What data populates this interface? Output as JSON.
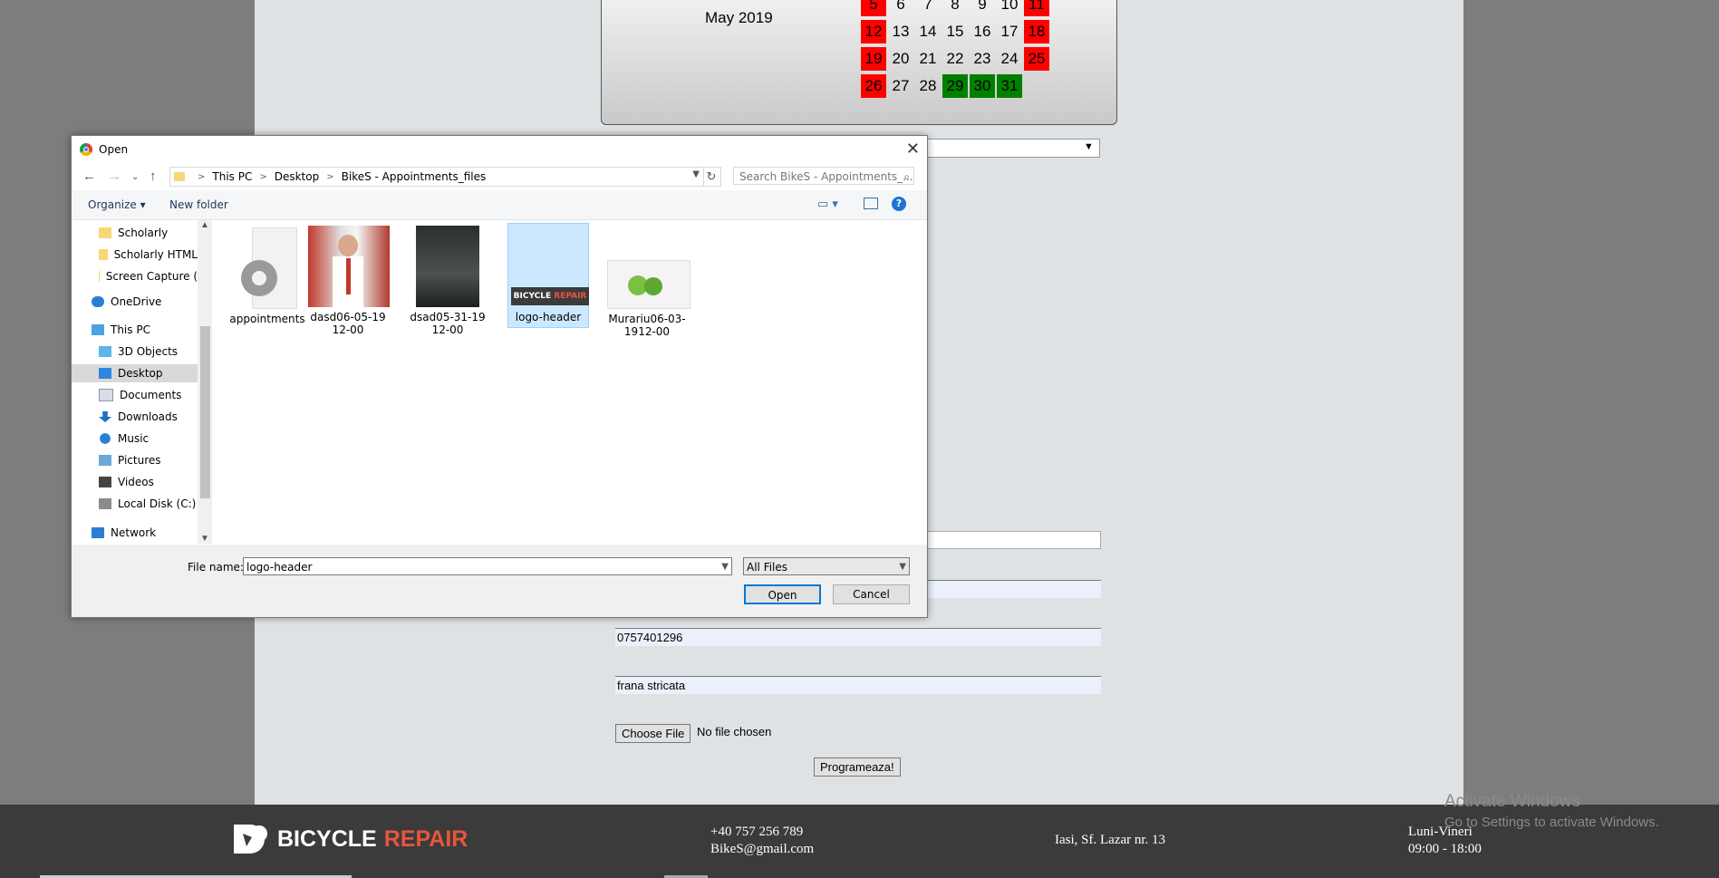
{
  "calendar": {
    "month_label": "May 2019",
    "rows": [
      [
        {
          "d": "5",
          "s": "red"
        },
        {
          "d": "6",
          "s": ""
        },
        {
          "d": "7",
          "s": ""
        },
        {
          "d": "8",
          "s": ""
        },
        {
          "d": "9",
          "s": ""
        },
        {
          "d": "10",
          "s": ""
        },
        {
          "d": "11",
          "s": "red"
        }
      ],
      [
        {
          "d": "12",
          "s": "red"
        },
        {
          "d": "13",
          "s": ""
        },
        {
          "d": "14",
          "s": ""
        },
        {
          "d": "15",
          "s": ""
        },
        {
          "d": "16",
          "s": ""
        },
        {
          "d": "17",
          "s": ""
        },
        {
          "d": "18",
          "s": "red"
        }
      ],
      [
        {
          "d": "19",
          "s": "red"
        },
        {
          "d": "20",
          "s": ""
        },
        {
          "d": "21",
          "s": ""
        },
        {
          "d": "22",
          "s": ""
        },
        {
          "d": "23",
          "s": ""
        },
        {
          "d": "24",
          "s": ""
        },
        {
          "d": "25",
          "s": "red"
        }
      ],
      [
        {
          "d": "26",
          "s": "red"
        },
        {
          "d": "27",
          "s": ""
        },
        {
          "d": "28",
          "s": ""
        },
        {
          "d": "29",
          "s": "green"
        },
        {
          "d": "30",
          "s": "green"
        },
        {
          "d": "31",
          "s": "green"
        }
      ]
    ],
    "colors": {
      "red": "#ff0000",
      "green": "#008000"
    }
  },
  "form": {
    "phone_value": "0757401296",
    "problem_value": "frana stricata",
    "choose_file_label": "Choose File",
    "no_file_text": "No file chosen",
    "submit_label": "Programeaza!"
  },
  "footer": {
    "logo_word1": "BICYCLE",
    "logo_word2": "REPAIR",
    "phone": "+40 757 256 789",
    "email": "BikeS@gmail.com",
    "address": "Iasi, Sf. Lazar nr. 13",
    "days": "Luni-Vineri",
    "hours": "09:00 - 18:00",
    "watermark_title": "Activate Windows",
    "watermark_text": "Go to Settings to activate Windows."
  },
  "dialog": {
    "title": "Open",
    "breadcrumb": [
      "This PC",
      "Desktop",
      "BikeS - Appointments_files"
    ],
    "search_placeholder": "Search BikeS - Appointments_...",
    "organize_label": "Organize",
    "new_folder_label": "New folder",
    "nav_items": [
      {
        "label": "Scholarly",
        "icon": "folder-icon"
      },
      {
        "label": "Scholarly HTML",
        "icon": "folder-icon"
      },
      {
        "label": "Screen Capture (",
        "icon": "folder-icon"
      },
      {
        "label": "OneDrive",
        "icon": "cloud-icon"
      },
      {
        "label": "This PC",
        "icon": "computer-icon"
      },
      {
        "label": "3D Objects",
        "icon": "cube-icon"
      },
      {
        "label": "Desktop",
        "icon": "desktop-icon"
      },
      {
        "label": "Documents",
        "icon": "document-icon"
      },
      {
        "label": "Downloads",
        "icon": "download-icon"
      },
      {
        "label": "Music",
        "icon": "music-icon"
      },
      {
        "label": "Pictures",
        "icon": "picture-icon"
      },
      {
        "label": "Videos",
        "icon": "video-icon"
      },
      {
        "label": "Local Disk (C:)",
        "icon": "disk-icon"
      },
      {
        "label": "Network",
        "icon": "network-icon"
      }
    ],
    "files": [
      {
        "name": "appointments",
        "kind": "settings-file-icon"
      },
      {
        "name": "dasd06-05-1912-00",
        "kind": "photo-thumbnail"
      },
      {
        "name": "dsad05-31-1912-00",
        "kind": "photo-thumbnail"
      },
      {
        "name": "logo-header",
        "kind": "logo-thumbnail"
      },
      {
        "name": "Murariu06-03-1912-00",
        "kind": "photo-thumbnail"
      }
    ],
    "thumb_logo_word1": "BICYCLE",
    "thumb_logo_word2": "REPAIR",
    "file_name_label": "File name:",
    "file_name_value": "logo-header",
    "file_type_value": "All Files",
    "open_label": "Open",
    "cancel_label": "Cancel",
    "accent_color": "#0078d7",
    "selection_color": "#cce8ff"
  }
}
